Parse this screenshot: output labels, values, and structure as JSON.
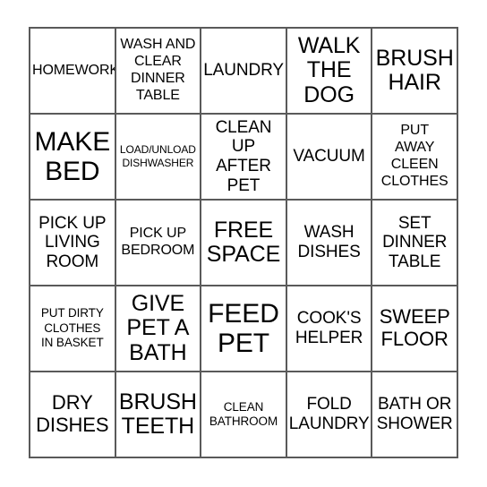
{
  "card": {
    "type": "bingo-card",
    "rows": 5,
    "columns": 5,
    "grid_border_color": "#5a5a5a",
    "text_color": "#000000",
    "background_color": "#ffffff",
    "free_space_cell": "FREE SPACE",
    "cells": [
      {
        "text": "HOMEWORK",
        "size": "sm"
      },
      {
        "text": "WASH AND\nCLEAR\nDINNER\nTABLE",
        "size": "sm"
      },
      {
        "text": "LAUNDRY",
        "size": "md"
      },
      {
        "text": "WALK\nTHE\nDOG",
        "size": "xl"
      },
      {
        "text": "BRUSH\nHAIR",
        "size": "xl"
      },
      {
        "text": "MAKE\nBED",
        "size": "xxl"
      },
      {
        "text": "LOAD/UNLOAD\nDISHWASHER",
        "size": "xxs"
      },
      {
        "text": "CLEAN\nUP\nAFTER\nPET",
        "size": "md"
      },
      {
        "text": "VACUUM",
        "size": "md"
      },
      {
        "text": "PUT\nAWAY\nCLEEN\nCLOTHES",
        "size": "sm"
      },
      {
        "text": "PICK UP\nLIVING\nROOM",
        "size": "md"
      },
      {
        "text": "PICK UP\nBEDROOM",
        "size": "sm"
      },
      {
        "text": "FREE\nSPACE",
        "size": "xl"
      },
      {
        "text": "WASH\nDISHES",
        "size": "md"
      },
      {
        "text": "SET\nDINNER\nTABLE",
        "size": "md"
      },
      {
        "text": "PUT DIRTY\nCLOTHES\nIN BASKET",
        "size": "xs"
      },
      {
        "text": "GIVE\nPET A\nBATH",
        "size": "xl"
      },
      {
        "text": "FEED\nPET",
        "size": "xxl"
      },
      {
        "text": "COOK'S\nHELPER",
        "size": "md"
      },
      {
        "text": "SWEEP\nFLOOR",
        "size": "lg"
      },
      {
        "text": "DRY\nDISHES",
        "size": "lg"
      },
      {
        "text": "BRUSH\nTEETH",
        "size": "xl"
      },
      {
        "text": "CLEAN\nBATHROOM",
        "size": "xs"
      },
      {
        "text": "FOLD\nLAUNDRY",
        "size": "md"
      },
      {
        "text": "BATH OR\nSHOWER",
        "size": "md"
      }
    ]
  }
}
